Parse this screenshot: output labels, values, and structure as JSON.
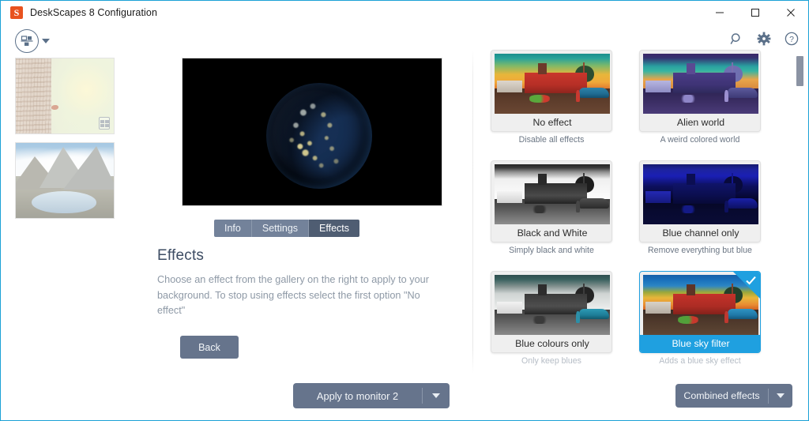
{
  "window": {
    "title": "DeskScapes 8 Configuration",
    "logo_letter": "S",
    "accent_color": "#1fa0e0",
    "controls": {
      "minimize": "minimize-button",
      "maximize": "maximize-button",
      "close": "close-button"
    }
  },
  "toolbar": {
    "monitor_picker_icon": "monitor-layout-icon",
    "search_icon": "search-icon",
    "settings_icon": "gear-icon",
    "help_icon": "help-icon"
  },
  "sidebar": {
    "thumbnails": [
      {
        "name": "tree-background-thumbnail",
        "badge": "monitor-badge-icon"
      },
      {
        "name": "mountain-lake-background-thumbnail",
        "badge": ""
      }
    ]
  },
  "center": {
    "preview_alt": "earth-at-night-preview",
    "tabs": [
      {
        "label": "Info",
        "active": false
      },
      {
        "label": "Settings",
        "active": false
      },
      {
        "label": "Effects",
        "active": true
      }
    ],
    "heading": "Effects",
    "description": "Choose an effect from the gallery on the right to apply to your background.  To stop using effects select the first option \"No effect\"",
    "back_label": "Back",
    "apply_label": "Apply to monitor 2"
  },
  "gallery": {
    "tiles": [
      {
        "title": "No effect",
        "subtitle": "Disable all effects",
        "selected": false,
        "variant": "v-normal",
        "faded": false
      },
      {
        "title": "Alien world",
        "subtitle": "A weird colored world",
        "selected": false,
        "variant": "v-alien",
        "faded": false
      },
      {
        "title": "Black and White",
        "subtitle": "Simply black and white",
        "selected": false,
        "variant": "v-bw",
        "faded": false
      },
      {
        "title": "Blue channel only",
        "subtitle": "Remove everything but blue",
        "selected": false,
        "variant": "v-bluechan",
        "faded": false
      },
      {
        "title": "Blue colours only",
        "subtitle": "Only keep blues",
        "selected": false,
        "variant": "v-bluecol",
        "faded": true
      },
      {
        "title": "Blue sky filter",
        "subtitle": "Adds a blue sky effect",
        "selected": true,
        "variant": "v-bluesky",
        "faded": true
      }
    ],
    "combined_label": "Combined effects"
  }
}
